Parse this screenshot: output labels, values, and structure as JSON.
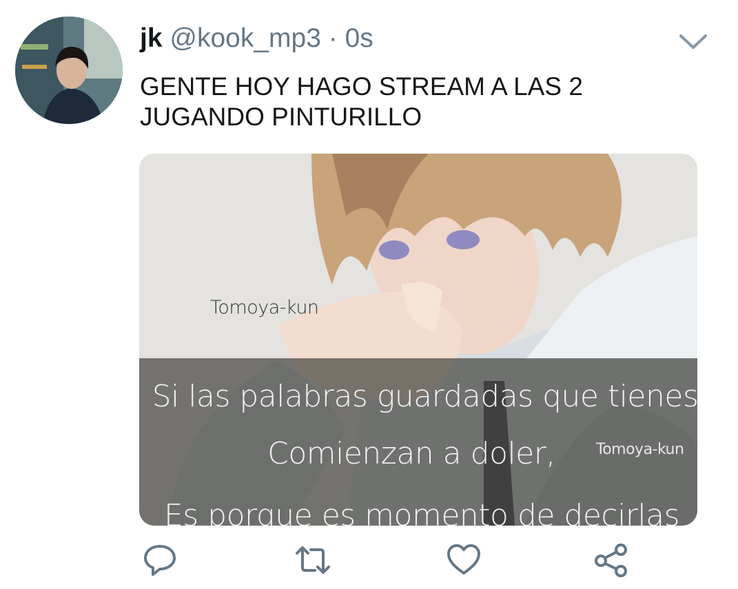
{
  "tweet": {
    "display_name": "jk",
    "handle": "@kook_mp3",
    "separator": "·",
    "time": "0s",
    "text_lines": [
      "GENTE HOY HAGO STREAM A LAS 2",
      "JUGANDO PINTURILLO"
    ],
    "caret_icon": "chevron-down-icon"
  },
  "media": {
    "watermark_top": "Tomoya-kun",
    "watermark_side": "Tomoya-kun",
    "quote_lines": [
      "Si las palabras guardadas que tienes",
      "Comienzan a doler,",
      "Es porque es momento de decirlas"
    ]
  },
  "actions": {
    "reply_icon": "reply-icon",
    "retweet_icon": "retweet-icon",
    "like_icon": "heart-icon",
    "share_icon": "share-icon"
  },
  "colors": {
    "icon_gray": "#657786",
    "text": "#14171a",
    "muted": "#657786"
  }
}
